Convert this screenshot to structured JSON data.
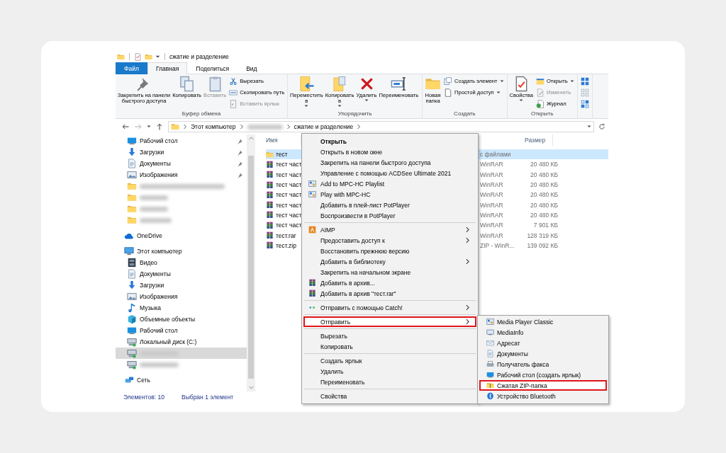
{
  "title_bar": {
    "title": "сжатие и разделение"
  },
  "tabs": [
    {
      "label": "Файл",
      "kind": "file",
      "selected": false
    },
    {
      "label": "Главная",
      "kind": "tab",
      "selected": true
    },
    {
      "label": "Поделиться",
      "kind": "tab",
      "selected": false
    },
    {
      "label": "Вид",
      "kind": "tab",
      "selected": false
    }
  ],
  "ribbon": {
    "groups": [
      {
        "label": "Буфер обмена",
        "columns": [
          {
            "kind": "large",
            "buttons": [
              {
                "label": "Закрепить на панели\nбыстрого доступа",
                "kind": "pin",
                "disabled": false,
                "dropdown": false
              }
            ]
          },
          {
            "kind": "large",
            "buttons": [
              {
                "label": "Копировать",
                "kind": "copy",
                "disabled": false,
                "dropdown": false
              }
            ]
          },
          {
            "kind": "large",
            "buttons": [
              {
                "label": "Вставить",
                "kind": "paste",
                "disabled": true,
                "dropdown": false
              }
            ]
          },
          {
            "kind": "small",
            "buttons": [
              {
                "label": "Вырезать",
                "kind": "cut",
                "disabled": false,
                "dropdown": false
              },
              {
                "label": "Скопировать путь",
                "kind": "copypath",
                "disabled": false,
                "dropdown": false
              },
              {
                "label": "Вставить ярлык",
                "kind": "shortcut",
                "disabled": true,
                "dropdown": false
              }
            ]
          }
        ]
      },
      {
        "label": "Упорядочить",
        "columns": [
          {
            "kind": "large",
            "buttons": [
              {
                "label": "Переместить\nв",
                "kind": "move",
                "disabled": false,
                "dropdown": true
              }
            ]
          },
          {
            "kind": "large",
            "buttons": [
              {
                "label": "Копировать\nв",
                "kind": "copyto",
                "disabled": false,
                "dropdown": true
              }
            ]
          },
          {
            "kind": "large",
            "buttons": [
              {
                "label": "Удалить",
                "kind": "delete",
                "disabled": false,
                "dropdown": true
              }
            ]
          },
          {
            "kind": "large",
            "buttons": [
              {
                "label": "Переименовать",
                "kind": "rename",
                "disabled": false,
                "dropdown": false
              }
            ]
          }
        ]
      },
      {
        "label": "Создать",
        "columns": [
          {
            "kind": "large",
            "buttons": [
              {
                "label": "Новая\nпапка",
                "kind": "newfolder",
                "disabled": false,
                "dropdown": false
              }
            ]
          },
          {
            "kind": "small",
            "buttons": [
              {
                "label": "Создать элемент",
                "kind": "newitem",
                "disabled": false,
                "dropdown": true
              },
              {
                "label": "Простой доступ",
                "kind": "easyaccess",
                "disabled": false,
                "dropdown": true
              }
            ]
          }
        ]
      },
      {
        "label": "Открыть",
        "columns": [
          {
            "kind": "large",
            "buttons": [
              {
                "label": "Свойства",
                "kind": "properties",
                "disabled": false,
                "dropdown": true
              }
            ]
          },
          {
            "kind": "small",
            "buttons": [
              {
                "label": "Открыть",
                "kind": "open",
                "disabled": false,
                "dropdown": true
              },
              {
                "label": "Изменить",
                "kind": "edit",
                "disabled": true,
                "dropdown": false
              },
              {
                "label": "Журнал",
                "kind": "history",
                "disabled": false,
                "dropdown": false
              }
            ]
          }
        ]
      },
      {
        "columns": [
          {
            "kind": "icons",
            "buttons": [
              {
                "kind": "selectall"
              },
              {
                "kind": "selectnone"
              },
              {
                "kind": "invert"
              }
            ]
          }
        ]
      }
    ]
  },
  "address_bar": {
    "path": [
      {
        "label": "Этот компьютер",
        "blurred": false
      },
      {
        "blurred": true
      },
      {
        "label": "сжатие и разделение",
        "blurred": false
      }
    ]
  },
  "nav_pane": {
    "quick_access": [
      {
        "label": "Рабочий стол",
        "kind": "desktop",
        "pinned": true,
        "selected": false,
        "blurred": false
      },
      {
        "label": "Загрузки",
        "kind": "downloads",
        "pinned": true,
        "selected": false,
        "blurred": false
      },
      {
        "label": "Документы",
        "kind": "documents",
        "pinned": true,
        "selected": false,
        "blurred": false
      },
      {
        "label": "Изображения",
        "kind": "pictures",
        "pinned": true,
        "selected": false,
        "blurred": false
      },
      {
        "kind": "folder",
        "pinned": false,
        "selected": false,
        "blurred": true
      },
      {
        "kind": "folder",
        "pinned": false,
        "selected": false,
        "blurred": true
      },
      {
        "kind": "folder",
        "pinned": false,
        "selected": false,
        "blurred": true
      },
      {
        "kind": "folder",
        "pinned": false,
        "selected": false,
        "blurred": true
      }
    ],
    "sections": [
      {
        "label": "OneDrive",
        "kind": "onedrive",
        "selected": false
      },
      {
        "label": "Этот компьютер",
        "kind": "pc",
        "selected": false,
        "children": [
          {
            "label": "Видео",
            "kind": "video",
            "selected": false,
            "blurred": false
          },
          {
            "label": "Документы",
            "kind": "documents",
            "selected": false,
            "blurred": false
          },
          {
            "label": "Загрузки",
            "kind": "downloads",
            "selected": false,
            "blurred": false
          },
          {
            "label": "Изображения",
            "kind": "pictures",
            "selected": false,
            "blurred": false
          },
          {
            "label": "Музыка",
            "kind": "music",
            "selected": false,
            "blurred": false
          },
          {
            "label": "Объемные объекты",
            "kind": "objects3d",
            "selected": false,
            "blurred": false
          },
          {
            "label": "Рабочий стол",
            "kind": "desktop",
            "selected": false,
            "blurred": false
          },
          {
            "label": "Локальный диск (C:)",
            "kind": "drive",
            "selected": false,
            "blurred": false
          },
          {
            "kind": "netdrive",
            "selected": true,
            "blurred": true
          },
          {
            "kind": "netdrive",
            "selected": false,
            "blurred": true
          }
        ]
      },
      {
        "label": "Сеть",
        "kind": "network",
        "selected": false
      }
    ]
  },
  "file_list": {
    "columns": [
      {
        "label": "Имя"
      },
      {
        "label": "Размер"
      }
    ],
    "rows": [
      {
        "name": "тест",
        "kind": "folder",
        "type": "с файлами",
        "size": "",
        "selected": true
      },
      {
        "name": "тест част",
        "kind": "archive",
        "type": "WinRAR",
        "size": "20 480 КБ",
        "selected": false
      },
      {
        "name": "тест част",
        "kind": "archive",
        "type": "WinRAR",
        "size": "20 480 КБ",
        "selected": false
      },
      {
        "name": "тест част",
        "kind": "archive",
        "type": "WinRAR",
        "size": "20 480 КБ",
        "selected": false
      },
      {
        "name": "тест част",
        "kind": "archive",
        "type": "WinRAR",
        "size": "20 480 КБ",
        "selected": false
      },
      {
        "name": "тест част",
        "kind": "archive",
        "type": "WinRAR",
        "size": "20 480 КБ",
        "selected": false
      },
      {
        "name": "тест част",
        "kind": "archive",
        "type": "WinRAR",
        "size": "20 480 КБ",
        "selected": false
      },
      {
        "name": "тест част",
        "kind": "archive",
        "type": "WinRAR",
        "size": "7 901 КБ",
        "selected": false
      },
      {
        "name": "тест.rar",
        "kind": "archive",
        "type": "WinRAR",
        "size": "128 319 КБ",
        "selected": false
      },
      {
        "name": "тест.zip",
        "kind": "archive",
        "type": "ZIP - WinR...",
        "size": "139 092 КБ",
        "selected": false
      }
    ]
  },
  "context_menu": {
    "sections": [
      [
        {
          "label": "Открыть",
          "kind": "plain",
          "bold": true,
          "submenu": false,
          "selected": false
        },
        {
          "label": "Открыть в новом окне",
          "kind": "plain",
          "bold": false,
          "submenu": false,
          "selected": false
        },
        {
          "label": "Закрепить на панели быстрого доступа",
          "kind": "plain",
          "bold": false,
          "submenu": false,
          "selected": false
        },
        {
          "label": "Управление с помощью ACDSee Ultimate 2021",
          "kind": "plain",
          "bold": false,
          "submenu": false,
          "selected": false
        },
        {
          "label": "Add to MPC-HC Playlist",
          "kind": "mpc",
          "bold": false,
          "submenu": false,
          "selected": false
        },
        {
          "label": "Play with MPC-HC",
          "kind": "mpc",
          "bold": false,
          "submenu": false,
          "selected": false
        },
        {
          "label": "Добавить в плей-лист PotPlayer",
          "kind": "plain",
          "bold": false,
          "submenu": false,
          "selected": false
        },
        {
          "label": "Воспроизвести в PotPlayer",
          "kind": "plain",
          "bold": false,
          "submenu": false,
          "selected": false
        }
      ],
      [
        {
          "label": "AIMP",
          "kind": "aimp",
          "bold": false,
          "submenu": true,
          "selected": false
        },
        {
          "label": "Предоставить доступ к",
          "kind": "plain",
          "bold": false,
          "submenu": true,
          "selected": false
        },
        {
          "label": "Восстановить прежнюю версию",
          "kind": "plain",
          "bold": false,
          "submenu": false,
          "selected": false
        },
        {
          "label": "Добавить в библиотеку",
          "kind": "plain",
          "bold": false,
          "submenu": true,
          "selected": false
        },
        {
          "label": "Закрепить на начальном экране",
          "kind": "plain",
          "bold": false,
          "submenu": false,
          "selected": false
        },
        {
          "label": "Добавить в архив...",
          "kind": "winrar",
          "bold": false,
          "submenu": false,
          "selected": false
        },
        {
          "label": "Добавить в архив \"тест.rar\"",
          "kind": "winrar",
          "bold": false,
          "submenu": false,
          "selected": false
        }
      ],
      [
        {
          "label": "Отправить с помощью Catch!",
          "kind": "catch",
          "bold": false,
          "submenu": true,
          "selected": false
        }
      ],
      [
        {
          "label": "Отправить",
          "kind": "plain",
          "bold": false,
          "submenu": true,
          "selected": true
        }
      ],
      [
        {
          "label": "Вырезать",
          "kind": "plain",
          "bold": false,
          "submenu": false,
          "selected": false
        },
        {
          "label": "Копировать",
          "kind": "plain",
          "bold": false,
          "submenu": false,
          "selected": false
        }
      ],
      [
        {
          "label": "Создать ярлык",
          "kind": "plain",
          "bold": false,
          "submenu": false,
          "selected": false
        },
        {
          "label": "Удалить",
          "kind": "plain",
          "bold": false,
          "submenu": false,
          "selected": false
        },
        {
          "label": "Переименовать",
          "kind": "plain",
          "bold": false,
          "submenu": false,
          "selected": false
        }
      ],
      [
        {
          "label": "Свойства",
          "kind": "plain",
          "bold": false,
          "submenu": false,
          "selected": false
        }
      ]
    ]
  },
  "send_to_menu": {
    "items": [
      {
        "label": "Media Player Classic",
        "kind": "mpc",
        "selected": false
      },
      {
        "label": "MediaInfo",
        "kind": "mediainfo",
        "selected": false
      },
      {
        "label": "Адресат",
        "kind": "mail",
        "selected": false
      },
      {
        "label": "Документы",
        "kind": "documents",
        "selected": false
      },
      {
        "label": "Получатель факса",
        "kind": "fax",
        "selected": false
      },
      {
        "label": "Рабочий стол (создать ярлык)",
        "kind": "desktop",
        "selected": false
      },
      {
        "label": "Сжатая ZIP-папка",
        "kind": "zip",
        "selected": true
      },
      {
        "label": "Устройство Bluetooth",
        "kind": "bluetooth",
        "selected": false
      }
    ]
  },
  "status_bar": {
    "items": [
      "Элементов: 10",
      "Выбран 1 элемент"
    ]
  }
}
